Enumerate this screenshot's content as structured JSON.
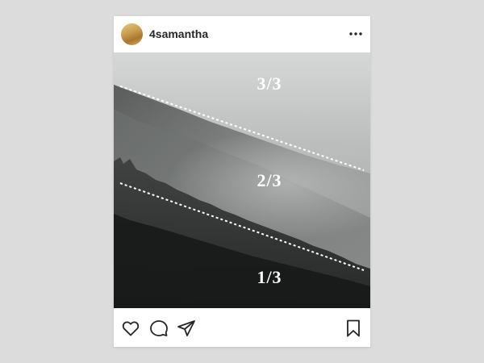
{
  "post": {
    "username": "4samantha",
    "thirds": {
      "top": "3/3",
      "middle": "2/3",
      "bottom": "1/3"
    }
  },
  "icons": {
    "more": "more-options-icon",
    "like": "heart-icon",
    "comment": "comment-icon",
    "share": "send-icon",
    "save": "bookmark-icon"
  },
  "colors": {
    "background": "#dcdcdc",
    "card": "#ffffff",
    "text": "#262626",
    "guide_lines": "#ffffff"
  }
}
